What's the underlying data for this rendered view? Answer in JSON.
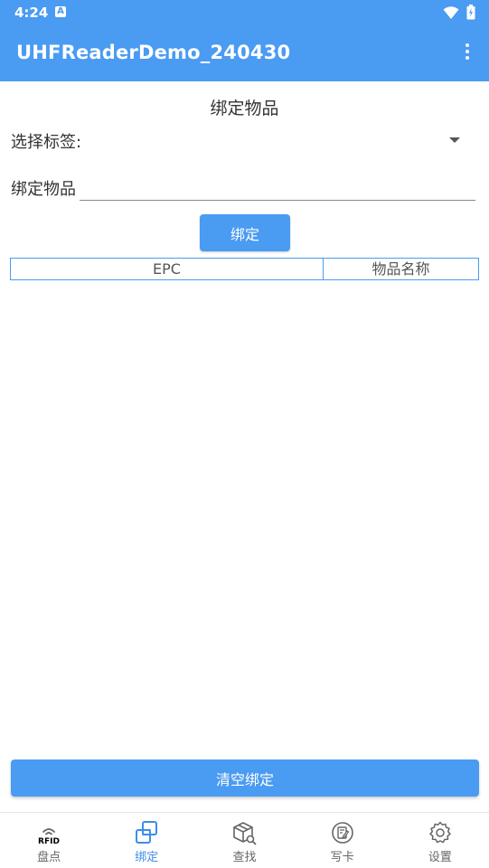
{
  "status_bar": {
    "time": "4:24",
    "notif_icon": "a-icon"
  },
  "app_bar": {
    "title": "UHFReaderDemo_240430",
    "menu_icon": "more-vert-icon"
  },
  "section": {
    "title": "绑定物品"
  },
  "form": {
    "select_label": "选择标签:",
    "select_value": "",
    "bind_label": "绑定物品",
    "bind_value": "",
    "bind_button": "绑定"
  },
  "table": {
    "columns": [
      "EPC",
      "物品名称"
    ],
    "rows": []
  },
  "actions": {
    "clear_button": "清空绑定"
  },
  "bottom_nav": {
    "items": [
      {
        "label": "盘点",
        "icon": "rfid-icon",
        "icon_text": "RFID",
        "active": false
      },
      {
        "label": "绑定",
        "icon": "bind-icon",
        "active": true
      },
      {
        "label": "查找",
        "icon": "box-search-icon",
        "active": false
      },
      {
        "label": "写卡",
        "icon": "write-card-icon",
        "active": false
      },
      {
        "label": "设置",
        "icon": "gear-icon",
        "active": false
      }
    ]
  },
  "colors": {
    "primary": "#4a9bf2",
    "active_nav": "#3b8ee8"
  }
}
